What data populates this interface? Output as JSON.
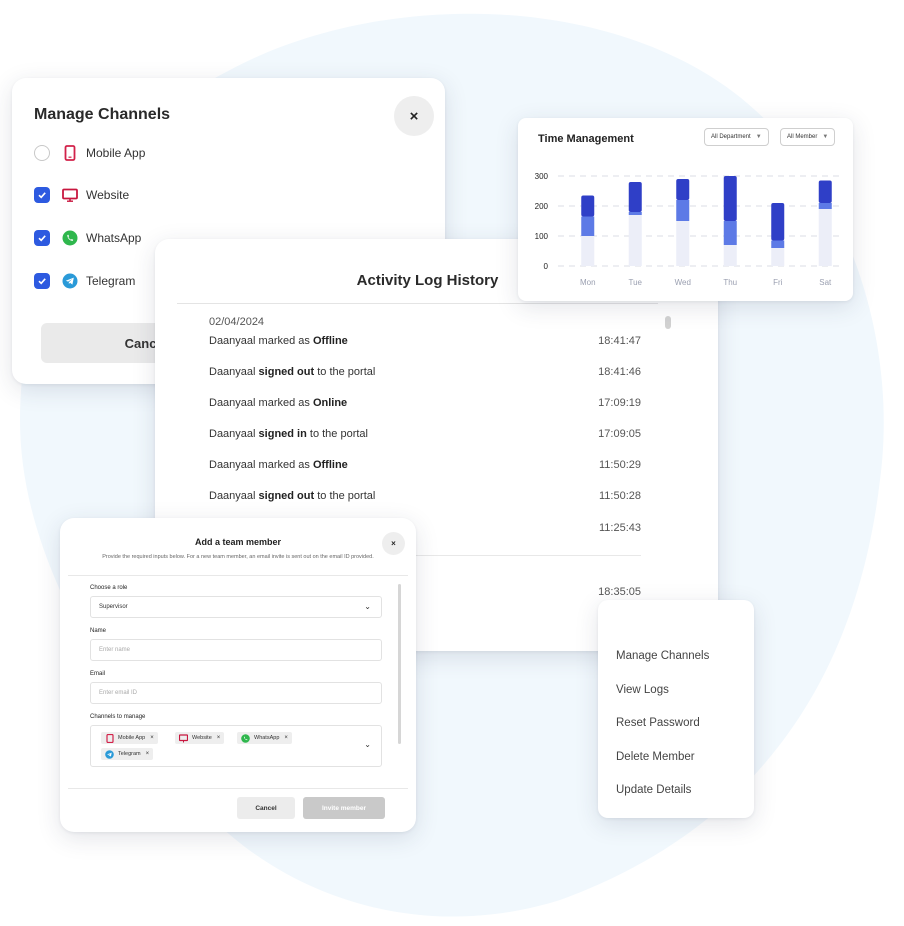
{
  "manage_channels": {
    "title": "Manage Channels",
    "close_label": "×",
    "cancel_label": "Cancel",
    "channels": [
      {
        "label": "Mobile App",
        "checked": false,
        "icon": "mobile-icon"
      },
      {
        "label": "Website",
        "checked": true,
        "icon": "monitor-icon"
      },
      {
        "label": "WhatsApp",
        "checked": true,
        "icon": "whatsapp-icon"
      },
      {
        "label": "Telegram",
        "checked": true,
        "icon": "telegram-icon"
      }
    ]
  },
  "activity_log": {
    "title": "Activity Log History",
    "date": "02/04/2024",
    "entries": [
      {
        "pre": "Daanyaal marked as ",
        "bold": "Offline",
        "post": "",
        "time": "18:41:47"
      },
      {
        "pre": "Daanyaal ",
        "bold": "signed out",
        "post": " to the portal",
        "time": "18:41:46"
      },
      {
        "pre": "Daanyaal marked as ",
        "bold": "Online",
        "post": "",
        "time": "17:09:19"
      },
      {
        "pre": "Daanyaal ",
        "bold": "signed in",
        "post": " to the portal",
        "time": "17:09:05"
      },
      {
        "pre": "Daanyaal marked as ",
        "bold": "Offline",
        "post": "",
        "time": "11:50:29"
      },
      {
        "pre": "Daanyaal ",
        "bold": "signed out",
        "post": " to the portal",
        "time": "11:50:28"
      },
      {
        "pre": "",
        "bold": "",
        "post": "",
        "time": "11:25:43"
      },
      {
        "pre": "",
        "bold": "",
        "post": "",
        "time": "18:35:05"
      }
    ]
  },
  "time_management": {
    "title": "Time Management",
    "filter_department": "All Department",
    "filter_member": "All Member",
    "colors": {
      "dark": "#2f3fc7",
      "mid": "#5d7ae6",
      "light": "#eceef8"
    }
  },
  "chart_data": {
    "type": "bar",
    "stacked": true,
    "categories": [
      "Mon",
      "Tue",
      "Wed",
      "Thu",
      "Fri",
      "Sat"
    ],
    "series": [
      {
        "values": [
          100,
          170,
          150,
          70,
          60,
          190
        ]
      },
      {
        "values": [
          65,
          10,
          70,
          80,
          25,
          20
        ]
      },
      {
        "values": [
          70,
          100,
          70,
          150,
          125,
          75
        ]
      }
    ],
    "y_ticks": [
      0,
      100,
      200,
      300
    ],
    "ylim": [
      0,
      300
    ],
    "grid": true
  },
  "add_member": {
    "title": "Add a team member",
    "subtitle": "Provide the required inputs below. For a new team member, an email invite is sent out on the email ID provided.",
    "close_label": "×",
    "role_label": "Choose a role",
    "role_value": "Supervisor",
    "name_label": "Name",
    "name_placeholder": "Enter name",
    "email_label": "Email",
    "email_placeholder": "Enter email ID",
    "channels_label": "Channels to manage",
    "chips": [
      {
        "label": "Mobile App",
        "icon": "mobile-icon"
      },
      {
        "label": "Website",
        "icon": "monitor-icon"
      },
      {
        "label": "WhatsApp",
        "icon": "whatsapp-icon"
      },
      {
        "label": "Telegram",
        "icon": "telegram-icon"
      }
    ],
    "chip_remove": "×",
    "cancel_label": "Cancel",
    "invite_label": "Invite member"
  },
  "menu": {
    "items": [
      "Manage Channels",
      "View Logs",
      "Reset Password",
      "Delete Member",
      "Update Details"
    ]
  }
}
